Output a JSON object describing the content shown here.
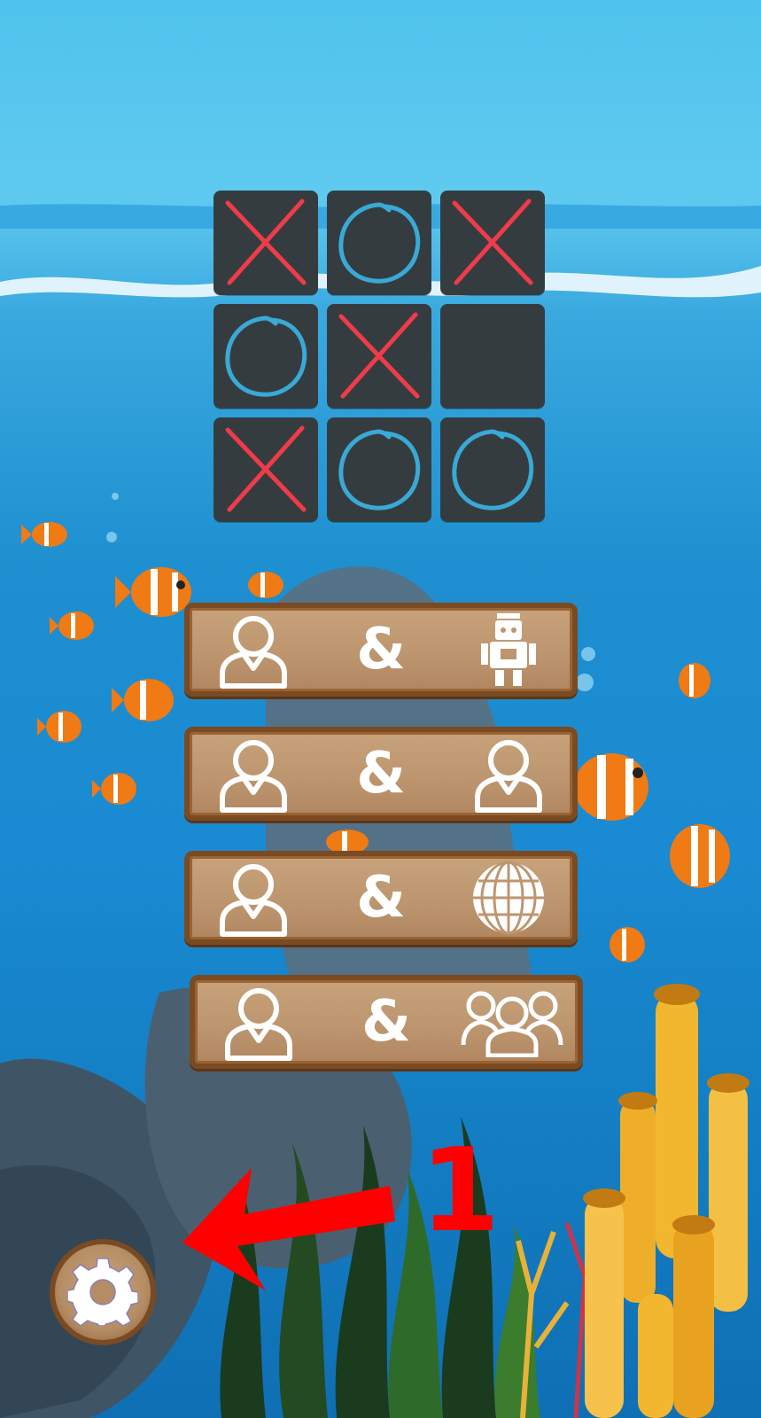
{
  "board": {
    "cells": [
      "X",
      "O",
      "X",
      "O",
      "X",
      "",
      "X",
      "O",
      "O"
    ]
  },
  "modes": [
    {
      "left_icon": "person-icon",
      "separator": "&",
      "right_icon": "robot-icon"
    },
    {
      "left_icon": "person-icon",
      "separator": "&",
      "right_icon": "person-icon"
    },
    {
      "left_icon": "person-icon",
      "separator": "&",
      "right_icon": "globe-icon"
    },
    {
      "left_icon": "person-icon",
      "separator": "&",
      "right_icon": "group-icon"
    }
  ],
  "settings": {
    "icon": "gear-icon"
  },
  "annotation": {
    "number": "1",
    "icon": "arrow-left-icon"
  },
  "colors": {
    "x_mark": "#ef3b4a",
    "o_mark": "#39a9d6",
    "cell_bg": "#353c40",
    "wood": "#bd9670",
    "wood_border": "#7a4a22",
    "annotation": "#ff0000"
  }
}
